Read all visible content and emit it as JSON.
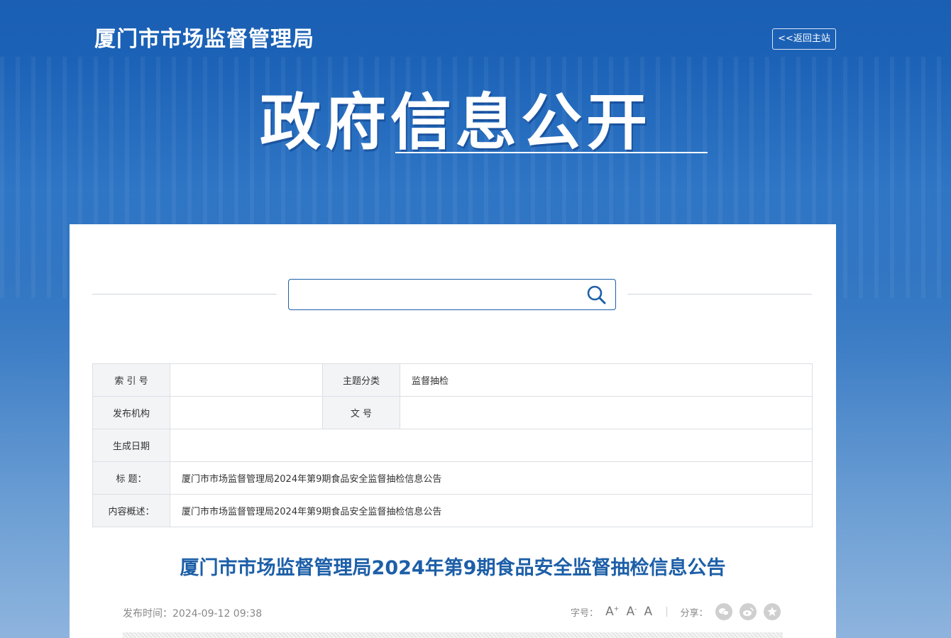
{
  "header": {
    "site_title": "厦门市市场监督管理局",
    "back_label": "<<返回主站",
    "banner_title": "政府信息公开"
  },
  "search": {
    "value": "",
    "placeholder": ""
  },
  "meta_table": {
    "index_label": "索 引 号",
    "index_value": "",
    "topic_label": "主题分类",
    "topic_value": "监督抽检",
    "publisher_label": "发布机构",
    "publisher_value": "",
    "docno_label": "文 号",
    "docno_value": "",
    "date_label": "生成日期",
    "date_value": "",
    "title_label": "标 题：",
    "title_value": "厦门市市场监督管理局2024年第9期食品安全监督抽检信息公告",
    "summary_label": "内容概述：",
    "summary_value": "厦门市市场监督管理局2024年第9期食品安全监督抽检信息公告"
  },
  "article": {
    "title": "厦门市市场监督管理局2024年第9期食品安全监督抽检信息公告",
    "publish_time": "发布时间：2024-09-12 09:38",
    "font_size_label": "字号：",
    "font_large": "A",
    "font_medium": "A",
    "font_small": "A",
    "share_label": "分享：",
    "share_icons": [
      "wechat-icon",
      "weibo-icon",
      "favorite-icon"
    ]
  },
  "colors": {
    "brand_blue": "#1d5fa8",
    "label_bg": "#f3f4f6"
  }
}
